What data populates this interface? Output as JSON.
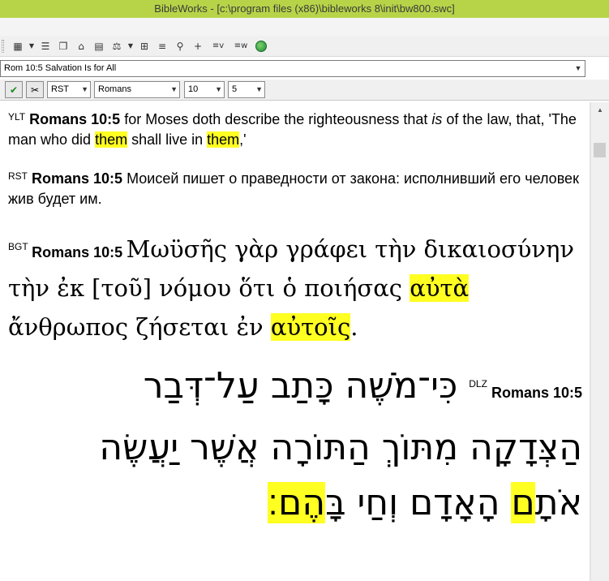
{
  "window": {
    "title": "BibleWorks - [c:\\program files (x86)\\bibleworks 8\\init\\bw800.swc]"
  },
  "toolbar": {
    "buttons": [
      "layout-icon",
      "list-icon",
      "copy-icon",
      "open-icon",
      "print-icon",
      "analysis-icon",
      "arrange-icon",
      "text-icon",
      "stamp-icon",
      "add-icon",
      "verse-icon",
      "word-icon",
      "globe-icon"
    ]
  },
  "reference_bar": {
    "value": "Rom 10:5 Salvation Is for All"
  },
  "options_bar": {
    "version": "RST",
    "book": "Romans",
    "chapter": "10",
    "verse": "5"
  },
  "verses": [
    {
      "version": "YLT",
      "reference": "Romans 10:5",
      "text_1": " for Moses doth describe the righteousness that ",
      "text_italic": "is",
      "text_2": " of the law, that, 'The man who did ",
      "hl_1": "them",
      "text_3": " shall live in ",
      "hl_2": "them",
      "text_4": ",'"
    },
    {
      "version": "RST",
      "reference": "Romans 10:5",
      "text": " Моисей пишет о праведности от закона: исполнивший его человек жив будет им."
    },
    {
      "version": "BGT",
      "reference": "Romans 10:5",
      "text_1": "Μωϋσῆς γὰρ γράφει τὴν δικαιοσύνην τὴν ἐκ [τοῦ] νόμου ὅτι ὁ ποιήσας ",
      "hl_1": "αὐτὰ",
      "text_2": " ἄνθρωπος ζήσεται ἐν ",
      "hl_2": "αὐτοῖς",
      "text_3": "."
    },
    {
      "version": "DLZ",
      "reference": "Romans 10:5",
      "text_1": "כִּי־מֹשֶׁה כָּתַב עַל־דְּבַר הַצְּדָקָה מִתּוֹךְ הַתּוֹרָה אֲשֶׁר יַעֲשֶׂה אֹתָ",
      "hl_1": "ם",
      "text_2": " הָאָדָם וְחַי ",
      "text_3": "בָּ",
      "hl_2": "הֶם׃"
    }
  ]
}
